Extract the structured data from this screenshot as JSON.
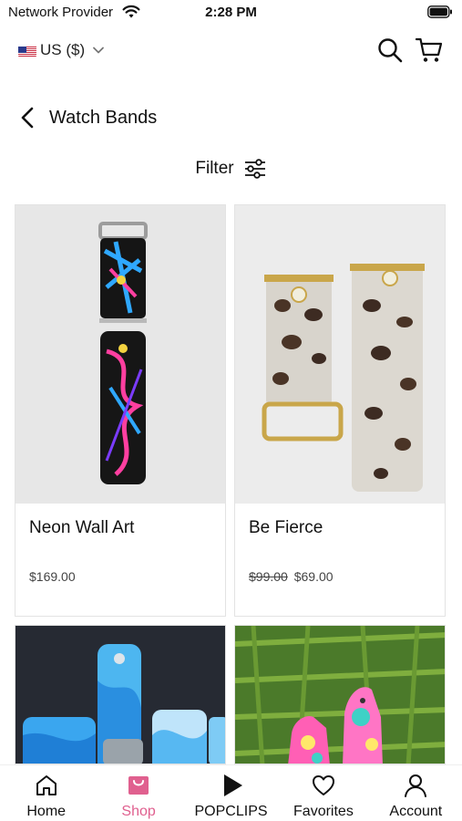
{
  "status": {
    "carrier": "Network Provider",
    "time": "2:28 PM"
  },
  "topbar": {
    "currency": "US ($)"
  },
  "page": {
    "title": "Watch Bands",
    "filter_label": "Filter"
  },
  "products": [
    {
      "name": "Neon Wall Art",
      "price": "$169.00",
      "compare_price": ""
    },
    {
      "name": "Be Fierce",
      "price": "$69.00",
      "compare_price": "$99.00"
    }
  ],
  "tabs": [
    {
      "label": "Home",
      "icon": "home-icon"
    },
    {
      "label": "Shop",
      "icon": "shopping-bag-icon"
    },
    {
      "label": "POPCLIPS",
      "icon": "play-icon"
    },
    {
      "label": "Favorites",
      "icon": "heart-icon"
    },
    {
      "label": "Account",
      "icon": "user-icon"
    }
  ],
  "colors": {
    "accent": "#e0608f",
    "text": "#111111",
    "border": "#e3e3e3"
  }
}
